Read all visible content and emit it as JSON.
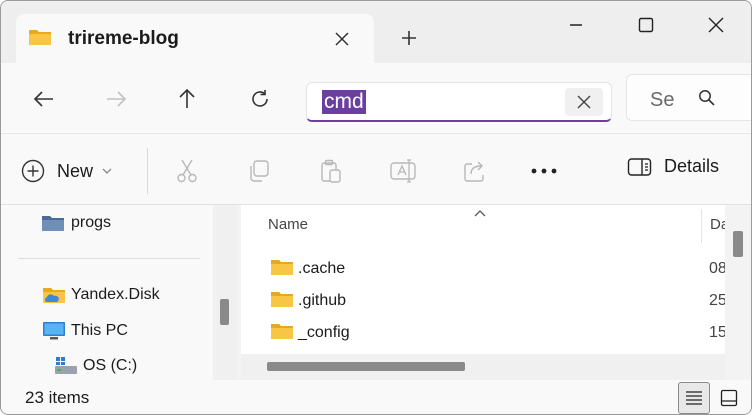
{
  "tab": {
    "title": "trireme-blog"
  },
  "address": {
    "value": "cmd"
  },
  "search": {
    "placeholder": "Se"
  },
  "commands": {
    "new_label": "New",
    "details_label": "Details"
  },
  "nav_pane": {
    "items": [
      {
        "label": "progs",
        "icon": "folder-icon"
      },
      {
        "label": "Yandex.Disk",
        "icon": "cloud-folder-icon"
      },
      {
        "label": "This PC",
        "icon": "monitor-icon"
      },
      {
        "label": "OS (C:)",
        "icon": "drive-icon"
      }
    ]
  },
  "columns": {
    "name": "Name",
    "date": "Da"
  },
  "files": [
    {
      "name": ".cache",
      "date": "08"
    },
    {
      "name": ".github",
      "date": "25"
    },
    {
      "name": "_config",
      "date": "15"
    }
  ],
  "status": {
    "item_count": "23 items"
  },
  "colors": {
    "accent": "#6b3fa1",
    "folder": "#f8c644",
    "folder_dark": "#e8a820"
  }
}
